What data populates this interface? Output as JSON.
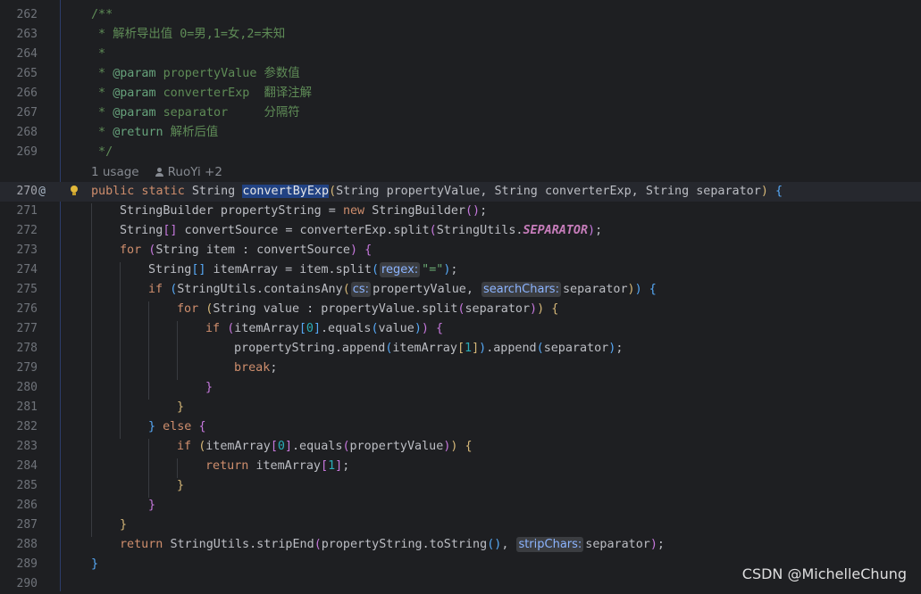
{
  "lines": [
    {
      "num": "262",
      "segments": [
        {
          "t": "/**",
          "c": "doc"
        }
      ]
    },
    {
      "num": "263",
      "segments": [
        {
          "t": " * 解析导出值 0=男,1=女,2=未知",
          "c": "doc"
        }
      ]
    },
    {
      "num": "264",
      "segments": [
        {
          "t": " *",
          "c": "doc"
        }
      ]
    },
    {
      "num": "265",
      "segments": [
        {
          "t": " * ",
          "c": "doc"
        },
        {
          "t": "@param",
          "c": "doctag"
        },
        {
          "t": " propertyValue 参数值",
          "c": "doc"
        }
      ]
    },
    {
      "num": "266",
      "segments": [
        {
          "t": " * ",
          "c": "doc"
        },
        {
          "t": "@param",
          "c": "doctag"
        },
        {
          "t": " converterExp  翻译注解",
          "c": "doc"
        }
      ]
    },
    {
      "num": "267",
      "segments": [
        {
          "t": " * ",
          "c": "doc"
        },
        {
          "t": "@param",
          "c": "doctag"
        },
        {
          "t": " separator     分隔符",
          "c": "doc"
        }
      ]
    },
    {
      "num": "268",
      "segments": [
        {
          "t": " * ",
          "c": "doc"
        },
        {
          "t": "@return",
          "c": "doctag"
        },
        {
          "t": " 解析后值",
          "c": "doc"
        }
      ]
    },
    {
      "num": "269",
      "segments": [
        {
          "t": " */",
          "c": "doc"
        }
      ]
    },
    {
      "num": "",
      "meta": true
    },
    {
      "num": "270",
      "current": true,
      "annot": "@",
      "bulb": true,
      "segments": [
        {
          "t": "public static ",
          "c": "kw"
        },
        {
          "t": "String ",
          "c": "cls"
        },
        {
          "t": "convertByExp",
          "c": "sel"
        },
        {
          "t": "(",
          "c": "p1"
        },
        {
          "t": "String ",
          "c": "cls"
        },
        {
          "t": "propertyValue, ",
          "c": "var"
        },
        {
          "t": "String ",
          "c": "cls"
        },
        {
          "t": "converterExp, ",
          "c": "var"
        },
        {
          "t": "String ",
          "c": "cls"
        },
        {
          "t": "separator",
          "c": "var"
        },
        {
          "t": ") ",
          "c": "p1"
        },
        {
          "t": "{",
          "c": "p3"
        }
      ]
    },
    {
      "num": "271",
      "indent": 1,
      "segments": [
        {
          "t": "StringBuilder ",
          "c": "cls"
        },
        {
          "t": "propertyString = ",
          "c": "plain"
        },
        {
          "t": "new ",
          "c": "kw"
        },
        {
          "t": "StringBuilder",
          "c": "cls"
        },
        {
          "t": "()",
          "c": "p2"
        },
        {
          "t": ";",
          "c": "plain"
        }
      ]
    },
    {
      "num": "272",
      "indent": 1,
      "segments": [
        {
          "t": "String",
          "c": "cls"
        },
        {
          "t": "[]",
          "c": "p2"
        },
        {
          "t": " convertSource = converterExp.split",
          "c": "plain"
        },
        {
          "t": "(",
          "c": "p2"
        },
        {
          "t": "StringUtils.",
          "c": "plain"
        },
        {
          "t": "SEPARATOR",
          "c": "const"
        },
        {
          "t": ")",
          "c": "p2"
        },
        {
          "t": ";",
          "c": "plain"
        }
      ]
    },
    {
      "num": "273",
      "indent": 1,
      "segments": [
        {
          "t": "for ",
          "c": "kw"
        },
        {
          "t": "(",
          "c": "p2"
        },
        {
          "t": "String ",
          "c": "cls"
        },
        {
          "t": "item : convertSource",
          "c": "plain"
        },
        {
          "t": ") ",
          "c": "p2"
        },
        {
          "t": "{",
          "c": "p2"
        }
      ]
    },
    {
      "num": "274",
      "indent": 2,
      "segments": [
        {
          "t": "String",
          "c": "cls"
        },
        {
          "t": "[]",
          "c": "p3"
        },
        {
          "t": " itemArray = item.split",
          "c": "plain"
        },
        {
          "t": "(",
          "c": "p3"
        },
        {
          "hint": "regex:"
        },
        {
          "t": "\"=\"",
          "c": "str"
        },
        {
          "t": ")",
          "c": "p3"
        },
        {
          "t": ";",
          "c": "plain"
        }
      ]
    },
    {
      "num": "275",
      "indent": 2,
      "segments": [
        {
          "t": "if ",
          "c": "kw"
        },
        {
          "t": "(",
          "c": "p3"
        },
        {
          "t": "StringUtils.containsAny",
          "c": "plain"
        },
        {
          "t": "(",
          "c": "p1"
        },
        {
          "hint": "cs:"
        },
        {
          "t": "propertyValue, ",
          "c": "plain"
        },
        {
          "hint": "searchChars:"
        },
        {
          "t": "separator",
          "c": "plain"
        },
        {
          "t": ")",
          "c": "p1"
        },
        {
          "t": ") ",
          "c": "p3"
        },
        {
          "t": "{",
          "c": "p3"
        }
      ]
    },
    {
      "num": "276",
      "indent": 3,
      "segments": [
        {
          "t": "for ",
          "c": "kw"
        },
        {
          "t": "(",
          "c": "p1"
        },
        {
          "t": "String ",
          "c": "cls"
        },
        {
          "t": "value : propertyValue.split",
          "c": "plain"
        },
        {
          "t": "(",
          "c": "p2"
        },
        {
          "t": "separator",
          "c": "plain"
        },
        {
          "t": ")",
          "c": "p2"
        },
        {
          "t": ") ",
          "c": "p1"
        },
        {
          "t": "{",
          "c": "p1"
        }
      ]
    },
    {
      "num": "277",
      "indent": 4,
      "segments": [
        {
          "t": "if ",
          "c": "kw"
        },
        {
          "t": "(",
          "c": "p2"
        },
        {
          "t": "itemArray",
          "c": "plain"
        },
        {
          "t": "[",
          "c": "p3"
        },
        {
          "t": "0",
          "c": "num"
        },
        {
          "t": "]",
          "c": "p3"
        },
        {
          "t": ".equals",
          "c": "plain"
        },
        {
          "t": "(",
          "c": "p3"
        },
        {
          "t": "value",
          "c": "plain"
        },
        {
          "t": ")",
          "c": "p3"
        },
        {
          "t": ") ",
          "c": "p2"
        },
        {
          "t": "{",
          "c": "p4"
        }
      ]
    },
    {
      "num": "278",
      "indent": 5,
      "segments": [
        {
          "t": "propertyString.append",
          "c": "plain"
        },
        {
          "t": "(",
          "c": "p3"
        },
        {
          "t": "itemArray",
          "c": "plain"
        },
        {
          "t": "[",
          "c": "p1"
        },
        {
          "t": "1",
          "c": "num"
        },
        {
          "t": "]",
          "c": "p1"
        },
        {
          "t": ")",
          "c": "p3"
        },
        {
          "t": ".append",
          "c": "plain"
        },
        {
          "t": "(",
          "c": "p3"
        },
        {
          "t": "separator",
          "c": "plain"
        },
        {
          "t": ")",
          "c": "p3"
        },
        {
          "t": ";",
          "c": "plain"
        }
      ]
    },
    {
      "num": "279",
      "indent": 5,
      "segments": [
        {
          "t": "break",
          "c": "kw"
        },
        {
          "t": ";",
          "c": "plain"
        }
      ]
    },
    {
      "num": "280",
      "indent": 4,
      "segments": [
        {
          "t": "}",
          "c": "p4"
        }
      ]
    },
    {
      "num": "281",
      "indent": 3,
      "segments": [
        {
          "t": "}",
          "c": "p1"
        }
      ]
    },
    {
      "num": "282",
      "indent": 2,
      "segments": [
        {
          "t": "} ",
          "c": "p3"
        },
        {
          "t": "else ",
          "c": "kw"
        },
        {
          "t": "{",
          "c": "p2"
        }
      ]
    },
    {
      "num": "283",
      "indent": 3,
      "segments": [
        {
          "t": "if ",
          "c": "kw"
        },
        {
          "t": "(",
          "c": "p1"
        },
        {
          "t": "itemArray",
          "c": "plain"
        },
        {
          "t": "[",
          "c": "p2"
        },
        {
          "t": "0",
          "c": "num"
        },
        {
          "t": "]",
          "c": "p2"
        },
        {
          "t": ".equals",
          "c": "plain"
        },
        {
          "t": "(",
          "c": "p2"
        },
        {
          "t": "propertyValue",
          "c": "plain"
        },
        {
          "t": ")",
          "c": "p2"
        },
        {
          "t": ") ",
          "c": "p1"
        },
        {
          "t": "{",
          "c": "p1"
        }
      ]
    },
    {
      "num": "284",
      "indent": 4,
      "segments": [
        {
          "t": "return ",
          "c": "kw"
        },
        {
          "t": "itemArray",
          "c": "plain"
        },
        {
          "t": "[",
          "c": "p2"
        },
        {
          "t": "1",
          "c": "num"
        },
        {
          "t": "]",
          "c": "p2"
        },
        {
          "t": ";",
          "c": "plain"
        }
      ]
    },
    {
      "num": "285",
      "indent": 3,
      "segments": [
        {
          "t": "}",
          "c": "p1"
        }
      ]
    },
    {
      "num": "286",
      "indent": 2,
      "segments": [
        {
          "t": "}",
          "c": "p2"
        }
      ]
    },
    {
      "num": "287",
      "indent": 1,
      "segments": [
        {
          "t": "}",
          "c": "p1"
        }
      ]
    },
    {
      "num": "288",
      "indent": 1,
      "segments": [
        {
          "t": "return ",
          "c": "kw"
        },
        {
          "t": "StringUtils.stripEnd",
          "c": "plain"
        },
        {
          "t": "(",
          "c": "p2"
        },
        {
          "t": "propertyString.toString",
          "c": "plain"
        },
        {
          "t": "()",
          "c": "p3"
        },
        {
          "t": ", ",
          "c": "plain"
        },
        {
          "hint": "stripChars:"
        },
        {
          "t": "separator",
          "c": "plain"
        },
        {
          "t": ")",
          "c": "p2"
        },
        {
          "t": ";",
          "c": "plain"
        }
      ]
    },
    {
      "num": "289",
      "segments": [
        {
          "t": "}",
          "c": "p3"
        }
      ]
    },
    {
      "num": "290",
      "segments": []
    }
  ],
  "meta": {
    "usage": "1 usage",
    "authors": "RuoYi +2"
  },
  "watermark": "CSDN @MichelleChung",
  "colors": {
    "background": "#1e1f22",
    "keyword": "#cf8e6d",
    "comment": "#5f8c57",
    "selection": "#214283",
    "function": "#56a8f5"
  }
}
